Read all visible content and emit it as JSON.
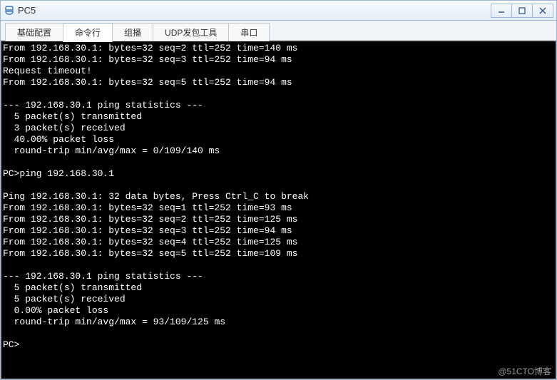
{
  "window": {
    "title": "PC5"
  },
  "tabs": [
    {
      "label": "基础配置",
      "active": false
    },
    {
      "label": "命令行",
      "active": true
    },
    {
      "label": "组播",
      "active": false
    },
    {
      "label": "UDP发包工具",
      "active": false
    },
    {
      "label": "串口",
      "active": false
    }
  ],
  "terminal": {
    "lines": [
      "From 192.168.30.1: bytes=32 seq=2 ttl=252 time=140 ms",
      "From 192.168.30.1: bytes=32 seq=3 ttl=252 time=94 ms",
      "Request timeout!",
      "From 192.168.30.1: bytes=32 seq=5 ttl=252 time=94 ms",
      "",
      "--- 192.168.30.1 ping statistics ---",
      "  5 packet(s) transmitted",
      "  3 packet(s) received",
      "  40.00% packet loss",
      "  round-trip min/avg/max = 0/109/140 ms",
      "",
      "PC>ping 192.168.30.1",
      "",
      "Ping 192.168.30.1: 32 data bytes, Press Ctrl_C to break",
      "From 192.168.30.1: bytes=32 seq=1 ttl=252 time=93 ms",
      "From 192.168.30.1: bytes=32 seq=2 ttl=252 time=125 ms",
      "From 192.168.30.1: bytes=32 seq=3 ttl=252 time=94 ms",
      "From 192.168.30.1: bytes=32 seq=4 ttl=252 time=125 ms",
      "From 192.168.30.1: bytes=32 seq=5 ttl=252 time=109 ms",
      "",
      "--- 192.168.30.1 ping statistics ---",
      "  5 packet(s) transmitted",
      "  5 packet(s) received",
      "  0.00% packet loss",
      "  round-trip min/avg/max = 93/109/125 ms",
      "",
      "PC>"
    ]
  },
  "watermark": "@51CTO博客"
}
